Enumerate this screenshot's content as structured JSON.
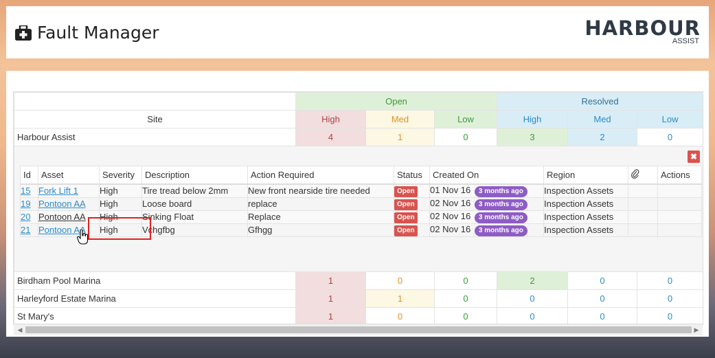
{
  "header": {
    "title": "Fault Manager",
    "title_icon": "medkit-icon",
    "logo_main": "HARBOUR",
    "logo_sub": "ASSIST"
  },
  "summary": {
    "group_open": "Open",
    "group_resolved": "Resolved",
    "site_label": "Site",
    "level_headers": [
      "High",
      "Med",
      "Low",
      "High",
      "Med",
      "Low"
    ],
    "rows": [
      {
        "site": "Harbour Assist",
        "values": [
          "4",
          "1",
          "0",
          "3",
          "2",
          "0"
        ]
      },
      {
        "site": "Birdham Pool Marina",
        "values": [
          "1",
          "0",
          "0",
          "2",
          "0",
          "0"
        ]
      },
      {
        "site": "Harleyford Estate Marina",
        "values": [
          "1",
          "1",
          "0",
          "0",
          "0",
          "0"
        ]
      },
      {
        "site": "St Mary's",
        "values": [
          "1",
          "0",
          "0",
          "0",
          "0",
          "0"
        ]
      }
    ]
  },
  "faults": {
    "close_label": "✖",
    "columns": [
      "Id",
      "Asset",
      "Severity",
      "Description",
      "Action Required",
      "Status",
      "Created On",
      "Region",
      "",
      "Actions"
    ],
    "rows": [
      {
        "id": "15",
        "asset": "Fork Lift 1",
        "severity": "High",
        "description": "Tire tread below 2mm",
        "action": "New front nearside tire needed",
        "status": "Open",
        "created": "01 Nov 16",
        "ago": "3 months ago",
        "region": "Inspection Assets"
      },
      {
        "id": "19",
        "asset": "Pontoon AA",
        "severity": "High",
        "description": "Loose board",
        "action": "replace",
        "status": "Open",
        "created": "02 Nov 16",
        "ago": "3 months ago",
        "region": "Inspection Assets"
      },
      {
        "id": "20",
        "asset": "Pontoon AA",
        "severity": "High",
        "description": "Sinking Float",
        "action": "Replace",
        "status": "Open",
        "created": "02 Nov 16",
        "ago": "3 months ago",
        "region": "Inspection Assets"
      },
      {
        "id": "21",
        "asset": "Pontoon AA",
        "severity": "High",
        "description": "Vchgfbg",
        "action": "Gfhgg",
        "status": "Open",
        "created": "02 Nov 16",
        "ago": "3 months ago",
        "region": "Inspection Assets"
      }
    ]
  },
  "colors": {
    "open_bg": "#dff0d8",
    "resolved_bg": "#d9edf7",
    "danger_bg": "#f2dede",
    "warning_bg": "#fcf8e3",
    "status_red": "#d9534f",
    "badge_purple": "#8e5cc5",
    "link_blue": "#2a8ac8"
  }
}
